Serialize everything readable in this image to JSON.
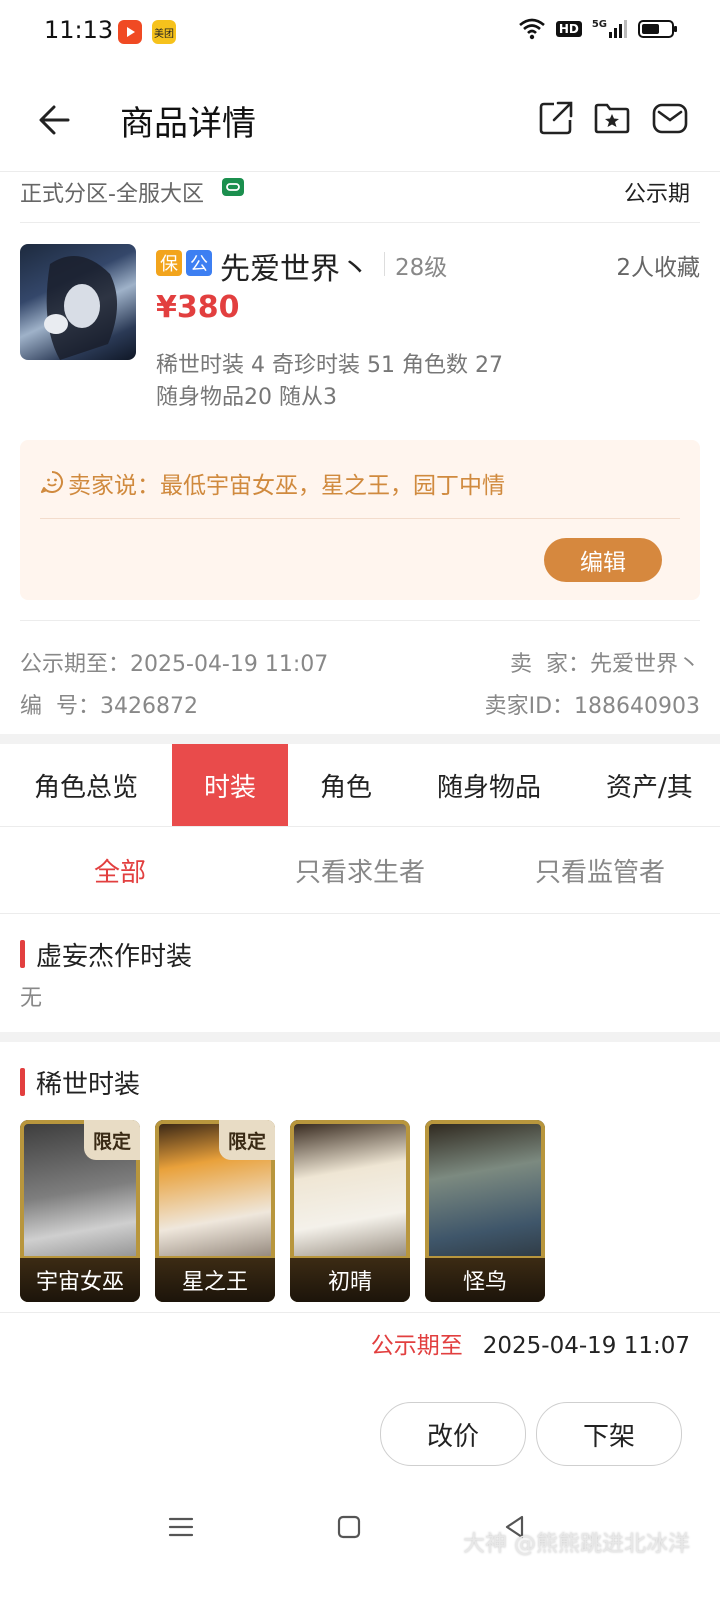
{
  "status_bar": {
    "time": "11:13",
    "app_badges": [
      {
        "icon": "video-app-icon",
        "color": "#f04a23",
        "text": ""
      },
      {
        "icon": "meituan-app-icon",
        "color": "#f6c21c",
        "text": "美团"
      }
    ],
    "hd_label": "HD",
    "signal_label": "5G",
    "battery_level": 0.6
  },
  "header": {
    "title": "商品详情"
  },
  "zone": {
    "label": "正式分区-全服大区",
    "period": "公示期"
  },
  "listing": {
    "tags": [
      {
        "text": "保",
        "color": "#f2a41c"
      },
      {
        "text": "公",
        "color": "#3d7ff2"
      }
    ],
    "seller_name": "先爱世界丶",
    "level": "28级",
    "favorites": "2人收藏",
    "price": "¥380",
    "stats_line1": "稀世时装 4 奇珍时装 51 角色数 27",
    "stats_line2": "随身物品20 随从3"
  },
  "seller_note": {
    "text": "卖家说：最低宇宙女巫，星之王，园丁中情",
    "edit_label": "编辑"
  },
  "meta": {
    "public_until_label": "公示期至：",
    "public_until_value": "2025-04-19 11:07",
    "seller_label": "卖  家：",
    "seller_value": "先爱世界丶",
    "number_label": "编  号：",
    "number_value": "3426872",
    "seller_id_label": "卖家ID：",
    "seller_id_value": "188640903"
  },
  "tabs": [
    {
      "label": "角色总览"
    },
    {
      "label": "时装"
    },
    {
      "label": "角色"
    },
    {
      "label": "随身物品"
    },
    {
      "label": "资产/其"
    }
  ],
  "subtabs": [
    {
      "label": "全部"
    },
    {
      "label": "只看求生者"
    },
    {
      "label": "只看监管者"
    }
  ],
  "sections": {
    "illusory": {
      "title": "虚妄杰作时装",
      "value": "无"
    },
    "rare": {
      "title": "稀世时装"
    }
  },
  "costumes": [
    {
      "name": "宇宙女巫",
      "badge": "限定"
    },
    {
      "name": "星之王",
      "badge": "限定"
    },
    {
      "name": "初晴",
      "badge": ""
    },
    {
      "name": "怪鸟",
      "badge": ""
    }
  ],
  "bottom": {
    "public_label": "公示期至",
    "public_value": "2025-04-19 11:07",
    "change_price_label": "改价",
    "delist_label": "下架"
  },
  "watermark": "大神 @熊熊跳进北冰洋",
  "colors": {
    "accent_red": "#e94b4b",
    "price_red": "#e23f3f",
    "orange": "#d6883e",
    "note_bg": "#fff5ee"
  }
}
